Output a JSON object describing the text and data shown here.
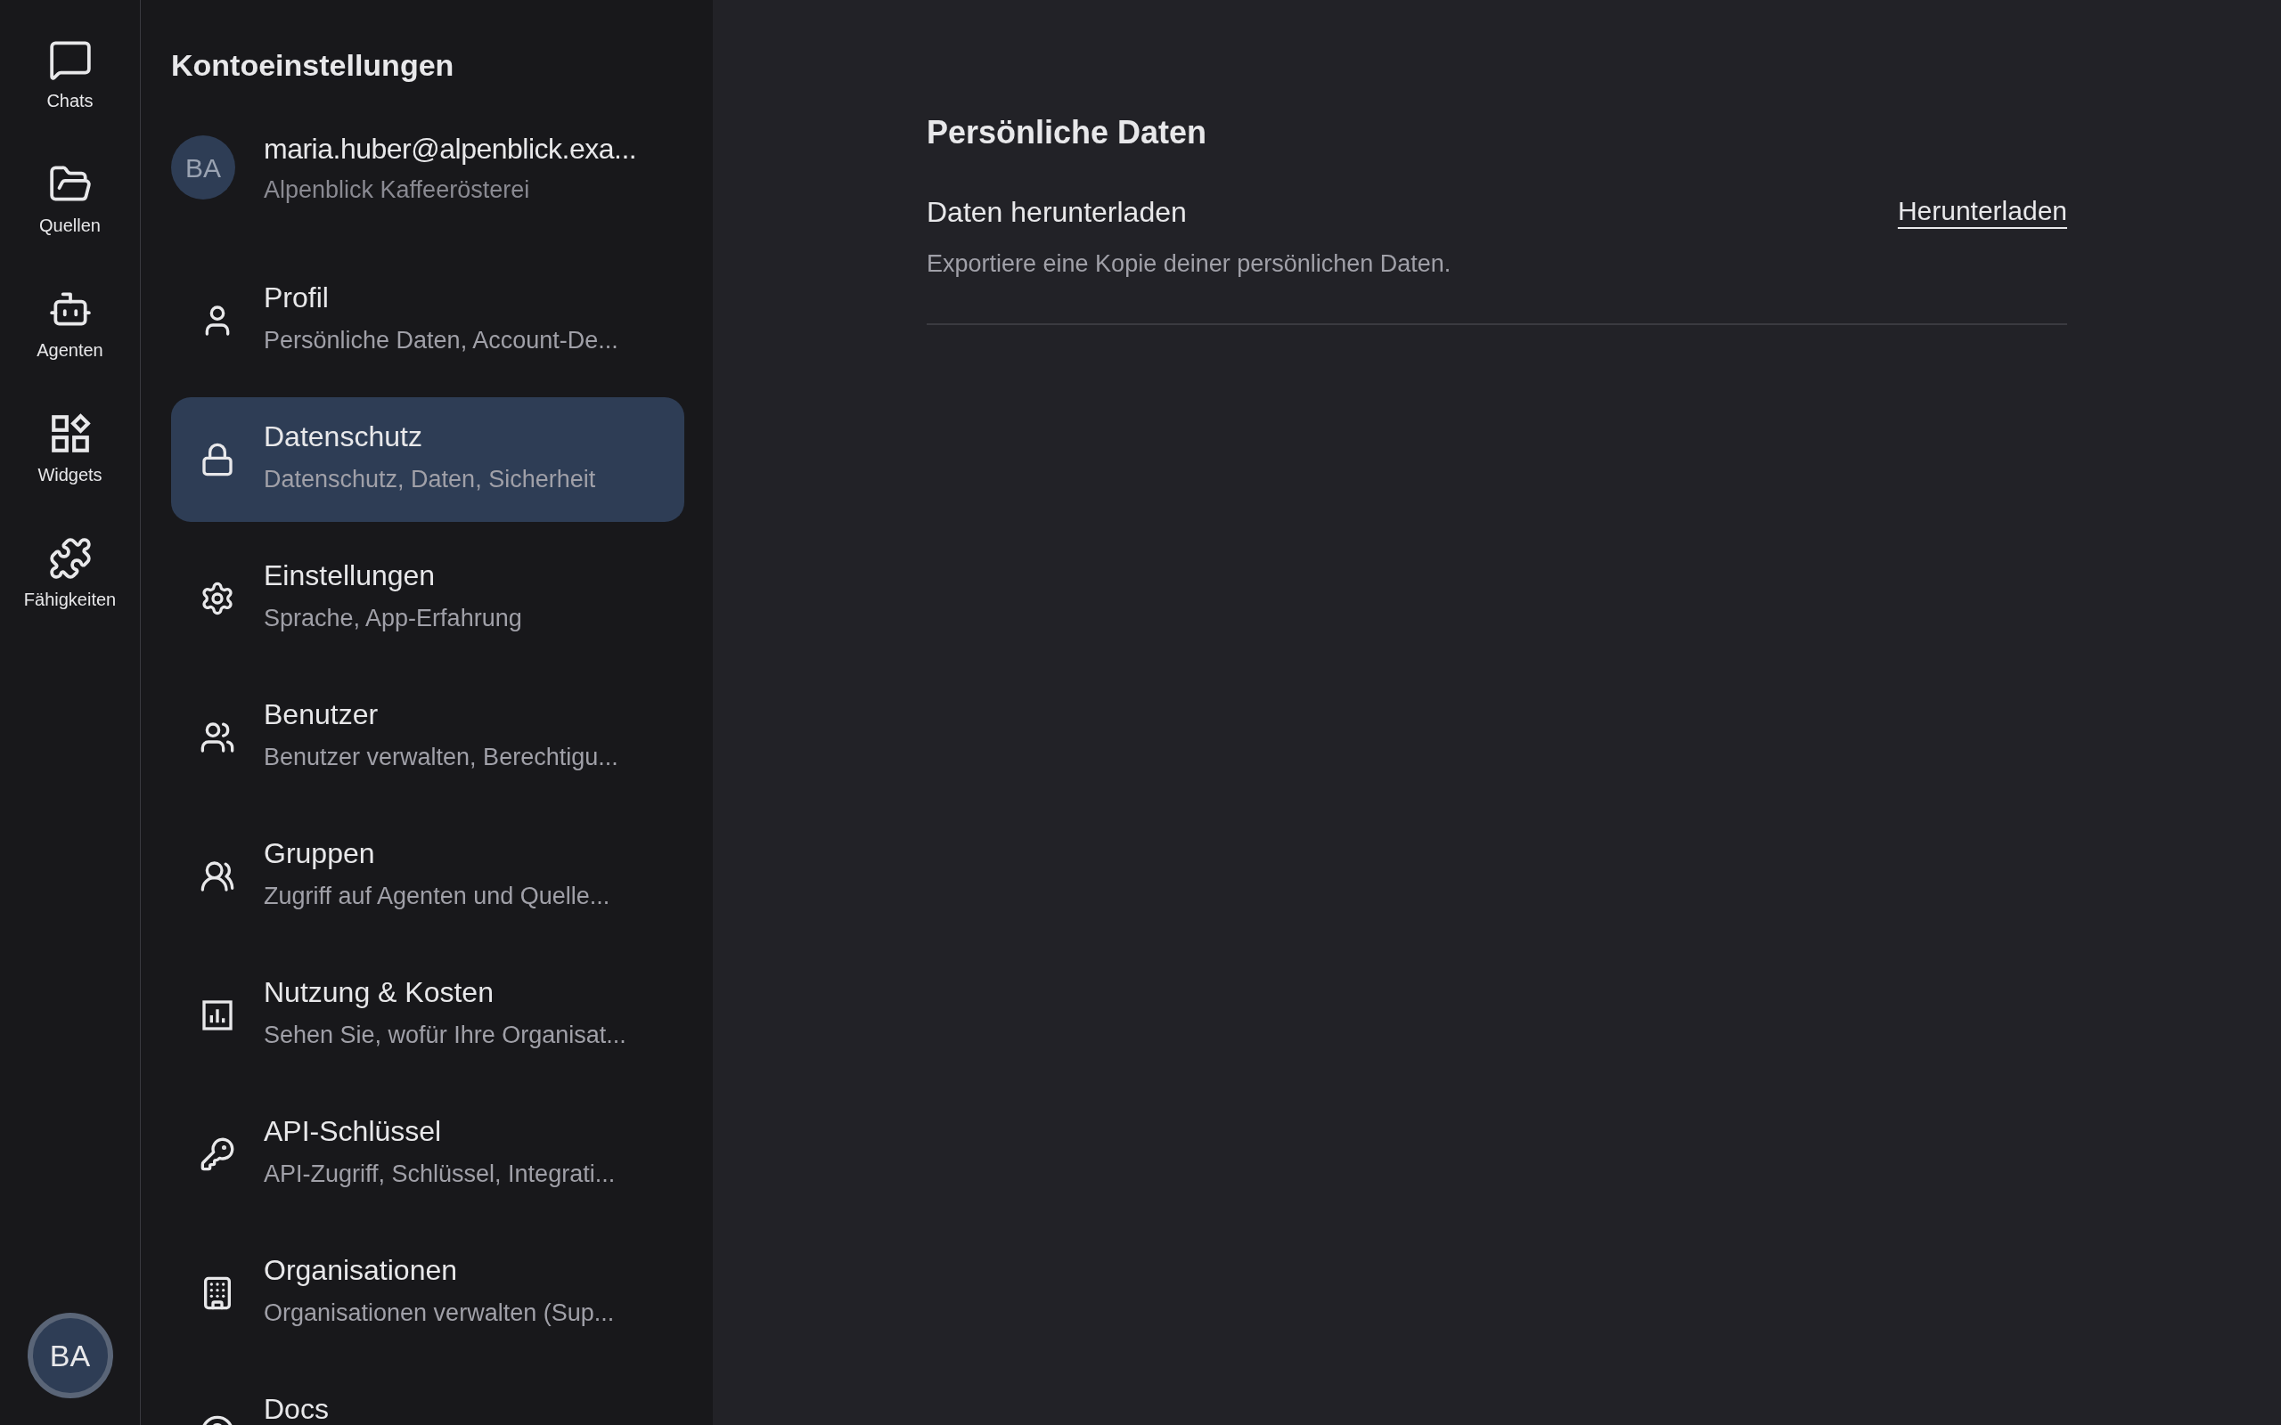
{
  "rail": {
    "items": [
      {
        "label": "Chats",
        "selected": false
      },
      {
        "label": "Quellen",
        "selected": false
      },
      {
        "label": "Agenten",
        "selected": false
      },
      {
        "label": "Widgets",
        "selected": false
      },
      {
        "label": "Fähigkeiten",
        "selected": false
      }
    ],
    "avatar": "BA"
  },
  "sidebar": {
    "title": "Kontoeinstellungen",
    "account": {
      "avatar": "BA",
      "email": "maria.huber@alpenblick.exa...",
      "organization": "Alpenblick Kaffeerösterei"
    },
    "items": [
      {
        "title": "Profil",
        "subtitle": "Persönliche Daten, Account-De...",
        "selected": false
      },
      {
        "title": "Datenschutz",
        "subtitle": "Datenschutz, Daten, Sicherheit",
        "selected": true
      },
      {
        "title": "Einstellungen",
        "subtitle": "Sprache, App-Erfahrung",
        "selected": false
      },
      {
        "title": "Benutzer",
        "subtitle": "Benutzer verwalten, Berechtigu...",
        "selected": false
      },
      {
        "title": "Gruppen",
        "subtitle": "Zugriff auf Agenten und Quelle...",
        "selected": false
      },
      {
        "title": "Nutzung & Kosten",
        "subtitle": "Sehen Sie, wofür Ihre Organisat...",
        "selected": false
      },
      {
        "title": "API-Schlüssel",
        "subtitle": "API-Zugriff, Schlüssel, Integrati...",
        "selected": false
      },
      {
        "title": "Organisationen",
        "subtitle": "Organisationen verwalten (Sup...",
        "selected": false
      },
      {
        "title": "Docs",
        "selected": false
      }
    ]
  },
  "main": {
    "heading": "Persönliche Daten",
    "rows": [
      {
        "title": "Daten herunterladen",
        "description": "Exportiere eine Kopie deiner persönlichen Daten.",
        "action": "Herunterladen"
      }
    ]
  }
}
